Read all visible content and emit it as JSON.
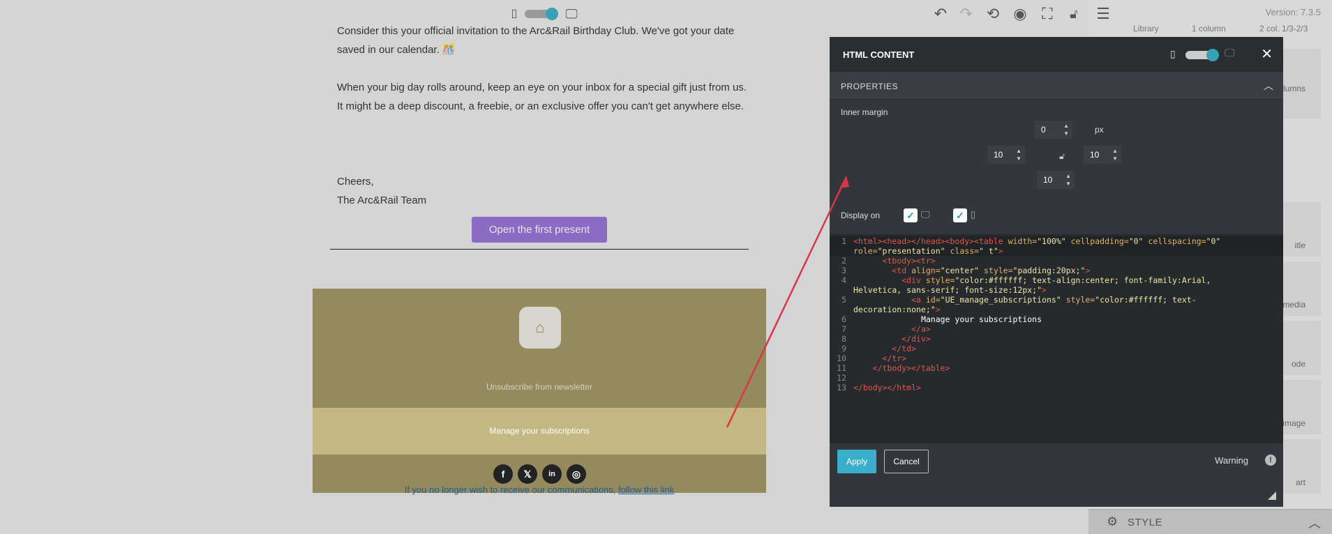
{
  "toolbar": {
    "icons": [
      "mobile-icon",
      "device-toggle",
      "desktop-icon",
      "undo-icon",
      "redo-icon",
      "history-icon",
      "preview-icon",
      "fullscreen-icon",
      "lock-icon",
      "menu-icon"
    ]
  },
  "sidebar": {
    "version": "Version: 7.3.5",
    "tabs": [
      "Library",
      "1 column",
      "2 col. 1/3-2/3"
    ],
    "tiles": [
      "lumns",
      "itle",
      "l media",
      "ode",
      "g image",
      "art"
    ],
    "style_label": "STYLE"
  },
  "email": {
    "paragraph1": "Consider this your official invitation to the Arc&Rail Birthday Club. We've got your date saved in our calendar. 🎊",
    "paragraph2": "When your big day rolls around, keep an eye on your inbox for a special gift just from us. It might be a deep discount, a freebie, or an exclusive offer you can't get anywhere else.",
    "signoff": "Cheers,",
    "team": "The Arc&Rail Team",
    "cta_label": "Open the first present",
    "logo_glyph": "⌂",
    "unsubscribe": "Unsubscribe from newsletter",
    "manage": "Manage your subscriptions",
    "socials": [
      "f",
      "𝕏",
      "in",
      "◎"
    ],
    "bottom_note": "If you no longer wish to receive our communications, ",
    "bottom_link": "follow this link"
  },
  "modal": {
    "title": "HTML CONTENT",
    "properties_label": "PROPERTIES",
    "inner_margin_label": "Inner margin",
    "margin_top": "0",
    "margin_left": "10",
    "margin_right": "10",
    "margin_bottom": "10",
    "unit": "px",
    "display_on_label": "Display on",
    "apply_label": "Apply",
    "cancel_label": "Cancel",
    "warning_label": "Warning"
  },
  "code_lines": [
    "1",
    "2",
    "3",
    "4",
    "5",
    "6",
    "7",
    "8",
    "9",
    "10",
    "11",
    "12",
    "13"
  ],
  "colors": {
    "accent": "#38aecb",
    "cta": "#8c6bc3",
    "footer": "#948a5e",
    "band": "#c3b783",
    "arrow": "#d9364a"
  }
}
